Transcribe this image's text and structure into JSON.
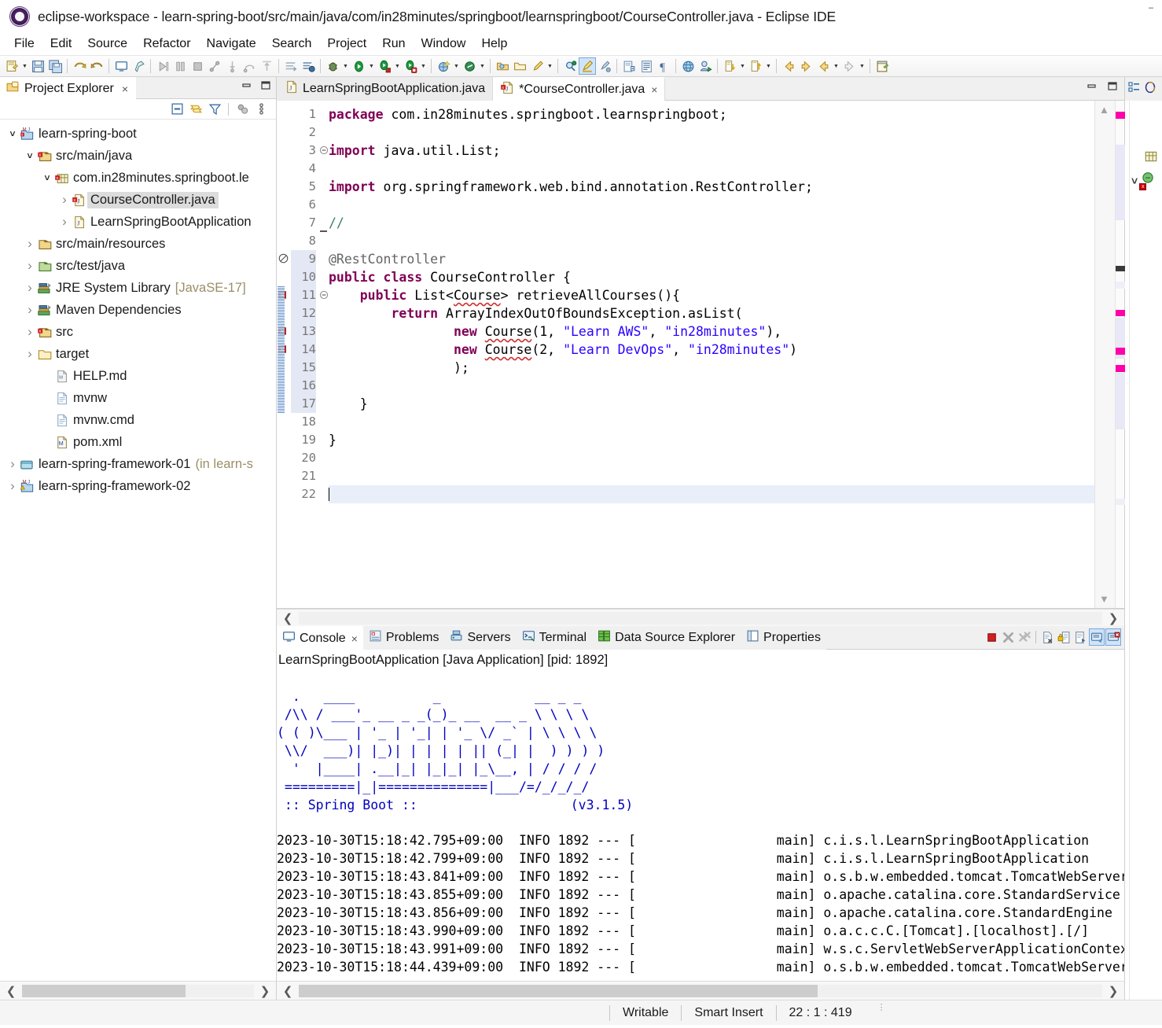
{
  "window": {
    "title": "eclipse-workspace - learn-spring-boot/src/main/java/com/in28minutes/springboot/learnspringboot/CourseController.java - Eclipse IDE",
    "app_icon": "eclipse-icon"
  },
  "menubar": {
    "items": [
      "File",
      "Edit",
      "Source",
      "Refactor",
      "Navigate",
      "Search",
      "Project",
      "Run",
      "Window",
      "Help"
    ]
  },
  "toolbar": {
    "groups": [
      {
        "items": [
          {
            "name": "new-wizard-icon",
            "arrow": true
          },
          {
            "name": "save-icon",
            "arrow": false
          },
          {
            "name": "save-all-icon",
            "arrow": false
          }
        ]
      },
      {
        "items": [
          {
            "name": "undo-icon",
            "arrow": false
          },
          {
            "name": "redo-icon",
            "arrow": false
          }
        ]
      },
      {
        "items": [
          {
            "name": "console-icon",
            "arrow": false
          },
          {
            "name": "pin-icon",
            "arrow": false
          }
        ]
      },
      {
        "items": [
          {
            "name": "resume-icon",
            "arrow": false
          },
          {
            "name": "suspend-icon",
            "arrow": false
          },
          {
            "name": "terminate-icon",
            "arrow": false
          },
          {
            "name": "disconnect-icon",
            "arrow": false
          },
          {
            "name": "step-into-icon",
            "arrow": false
          },
          {
            "name": "step-over-icon",
            "arrow": false
          },
          {
            "name": "step-return-icon",
            "arrow": false
          }
        ]
      },
      {
        "items": [
          {
            "name": "skip-breakpoints-icon",
            "arrow": false
          },
          {
            "name": "toggle-step-filters-icon",
            "arrow": false
          }
        ]
      },
      {
        "items": [
          {
            "name": "debug-icon",
            "arrow": true
          },
          {
            "name": "run-icon",
            "arrow": true
          },
          {
            "name": "run-as-server-icon",
            "arrow": true
          },
          {
            "name": "debug-as-server-icon",
            "arrow": true
          }
        ]
      },
      {
        "items": [
          {
            "name": "new-spring-starter-icon",
            "arrow": true
          },
          {
            "name": "boot-dashboard-icon",
            "arrow": true
          }
        ]
      },
      {
        "items": [
          {
            "name": "open-type-icon",
            "arrow": false
          },
          {
            "name": "open-task-icon",
            "arrow": false
          },
          {
            "name": "quick-access-icon",
            "arrow": true
          }
        ]
      },
      {
        "items": [
          {
            "name": "search-icon",
            "arrow": false
          },
          {
            "name": "highlight-icon",
            "arrow": false,
            "active": true
          },
          {
            "name": "toggle-mark-occurrences-icon",
            "arrow": false
          }
        ]
      },
      {
        "items": [
          {
            "name": "new-java-project-icon",
            "arrow": false
          },
          {
            "name": "new-class-icon",
            "arrow": false
          },
          {
            "name": "show-whitespace-icon",
            "arrow": false
          }
        ]
      },
      {
        "items": [
          {
            "name": "open-web-browser-icon",
            "arrow": false
          },
          {
            "name": "profile-icon",
            "arrow": false
          }
        ]
      },
      {
        "items": [
          {
            "name": "next-annotation-icon",
            "arrow": true
          },
          {
            "name": "previous-annotation-icon",
            "arrow": true
          }
        ]
      },
      {
        "items": [
          {
            "name": "back-icon",
            "arrow": false
          },
          {
            "name": "forward-icon",
            "arrow": false
          },
          {
            "name": "previous-edit-icon",
            "arrow": true
          },
          {
            "name": "next-edit-icon",
            "arrow": true
          }
        ]
      },
      {
        "items": [
          {
            "name": "new-window-icon",
            "arrow": false
          }
        ]
      }
    ]
  },
  "project_explorer": {
    "tab_label": "Project Explorer",
    "tab_icon": "project-explorer-icon",
    "close_label": "×",
    "view_tools": [
      "collapse-all-icon",
      "link-with-editor-icon",
      "filter-icon",
      "focus-active-task-icon",
      "view-menu-icon"
    ],
    "window_buttons": [
      "minimize-icon",
      "maximize-icon"
    ],
    "tree": [
      {
        "label": "learn-spring-boot",
        "indent": 0,
        "twisty": "open",
        "icon": "maven-java-project",
        "selected": false
      },
      {
        "label": "src/main/java",
        "indent": 1,
        "twisty": "open",
        "icon": "source-folder-error",
        "selected": false
      },
      {
        "label": "com.in28minutes.springboot.le",
        "indent": 2,
        "twisty": "open",
        "icon": "package-error",
        "selected": false
      },
      {
        "label": "CourseController.java",
        "indent": 3,
        "twisty": "closed",
        "icon": "java-file-error",
        "selected": true
      },
      {
        "label": "LearnSpringBootApplication",
        "indent": 3,
        "twisty": "closed",
        "icon": "java-file",
        "selected": false
      },
      {
        "label": "src/main/resources",
        "indent": 1,
        "twisty": "closed",
        "icon": "resource-folder",
        "selected": false
      },
      {
        "label": "src/test/java",
        "indent": 1,
        "twisty": "closed",
        "icon": "test-source-folder",
        "selected": false
      },
      {
        "label": "JRE System Library",
        "indent": 1,
        "twisty": "closed",
        "icon": "library",
        "selected": false,
        "suffix": "[JavaSE-17]"
      },
      {
        "label": "Maven Dependencies",
        "indent": 1,
        "twisty": "closed",
        "icon": "library",
        "selected": false
      },
      {
        "label": "src",
        "indent": 1,
        "twisty": "closed",
        "icon": "folder-error",
        "selected": false
      },
      {
        "label": "target",
        "indent": 1,
        "twisty": "closed",
        "icon": "folder",
        "selected": false
      },
      {
        "label": "HELP.md",
        "indent": 2,
        "twisty": "none",
        "icon": "markdown-file",
        "selected": false
      },
      {
        "label": "mvnw",
        "indent": 2,
        "twisty": "none",
        "icon": "text-file",
        "selected": false
      },
      {
        "label": "mvnw.cmd",
        "indent": 2,
        "twisty": "none",
        "icon": "text-file",
        "selected": false
      },
      {
        "label": "pom.xml",
        "indent": 2,
        "twisty": "none",
        "icon": "maven-pom-file",
        "selected": false
      },
      {
        "label": "learn-spring-framework-01",
        "indent": 0,
        "twisty": "closed",
        "icon": "closed-project",
        "selected": false,
        "suffix": "(in learn-s"
      },
      {
        "label": "learn-spring-framework-02",
        "indent": 0,
        "twisty": "closed",
        "icon": "maven-java-project-warn",
        "selected": false
      }
    ]
  },
  "editor": {
    "tabs": [
      {
        "label": "LearnSpringBootApplication.java",
        "icon": "java-file",
        "active": false,
        "dirty": false,
        "closable": false
      },
      {
        "label": "*CourseController.java",
        "icon": "java-file-error",
        "active": true,
        "dirty": true,
        "closable": true
      }
    ],
    "close_label": "×",
    "window_buttons": [
      "minimize-icon",
      "maximize-icon"
    ],
    "first_line": 1,
    "line_count": 22,
    "gutter_markers": [
      {
        "line": 9,
        "type": "warning-marker"
      },
      {
        "line": 11,
        "type": "error-marker"
      },
      {
        "line": 13,
        "type": "error-marker"
      },
      {
        "line": 14,
        "type": "error-marker"
      }
    ],
    "fold_markers": [
      3,
      11
    ],
    "highlighted_line": 22,
    "lines": [
      {
        "n": 1,
        "tokens": [
          {
            "t": "package ",
            "c": "kw"
          },
          {
            "t": "com.in28minutes.springboot.learnspringboot;",
            "c": "plain"
          }
        ]
      },
      {
        "n": 2,
        "tokens": []
      },
      {
        "n": 3,
        "tokens": [
          {
            "t": "import ",
            "c": "kw"
          },
          {
            "t": "java.util.List;",
            "c": "plain"
          }
        ]
      },
      {
        "n": 4,
        "tokens": []
      },
      {
        "n": 5,
        "tokens": [
          {
            "t": "import ",
            "c": "kw"
          },
          {
            "t": "org.springframework.web.bind.annotation.RestController;",
            "c": "plain"
          }
        ]
      },
      {
        "n": 6,
        "tokens": []
      },
      {
        "n": 7,
        "tokens": [
          {
            "t": "//",
            "c": "cmt"
          }
        ]
      },
      {
        "n": 8,
        "tokens": []
      },
      {
        "n": 9,
        "tokens": [
          {
            "t": "@RestController",
            "c": "ann"
          }
        ]
      },
      {
        "n": 10,
        "tokens": [
          {
            "t": "public class ",
            "c": "kw"
          },
          {
            "t": "CourseController {",
            "c": "plain"
          }
        ]
      },
      {
        "n": 11,
        "tokens": [
          {
            "t": "    ",
            "c": "plain"
          },
          {
            "t": "public ",
            "c": "kw"
          },
          {
            "t": "List<",
            "c": "plain"
          },
          {
            "t": "Course",
            "c": "plain err"
          },
          {
            "t": "> retrieveAllCourses(){",
            "c": "plain"
          }
        ]
      },
      {
        "n": 12,
        "tokens": [
          {
            "t": "        ",
            "c": "plain"
          },
          {
            "t": "return ",
            "c": "kw"
          },
          {
            "t": "ArrayIndexOutOfBoundsException.asList(",
            "c": "plain"
          }
        ]
      },
      {
        "n": 13,
        "tokens": [
          {
            "t": "                ",
            "c": "plain"
          },
          {
            "t": "new ",
            "c": "kw"
          },
          {
            "t": "Course",
            "c": "plain err"
          },
          {
            "t": "(1, ",
            "c": "plain"
          },
          {
            "t": "\"Learn AWS\"",
            "c": "str"
          },
          {
            "t": ", ",
            "c": "plain"
          },
          {
            "t": "\"in28minutes\"",
            "c": "str"
          },
          {
            "t": "),",
            "c": "plain"
          }
        ]
      },
      {
        "n": 14,
        "tokens": [
          {
            "t": "                ",
            "c": "plain"
          },
          {
            "t": "new ",
            "c": "kw"
          },
          {
            "t": "Course",
            "c": "plain err"
          },
          {
            "t": "(2, ",
            "c": "plain"
          },
          {
            "t": "\"Learn DevOps\"",
            "c": "str"
          },
          {
            "t": ", ",
            "c": "plain"
          },
          {
            "t": "\"in28minutes\"",
            "c": "str"
          },
          {
            "t": ")",
            "c": "plain"
          }
        ]
      },
      {
        "n": 15,
        "tokens": [
          {
            "t": "                );",
            "c": "plain"
          }
        ]
      },
      {
        "n": 16,
        "tokens": []
      },
      {
        "n": 17,
        "tokens": [
          {
            "t": "    }",
            "c": "plain"
          }
        ]
      },
      {
        "n": 18,
        "tokens": []
      },
      {
        "n": 19,
        "tokens": [
          {
            "t": "}",
            "c": "plain"
          }
        ]
      },
      {
        "n": 20,
        "tokens": []
      },
      {
        "n": 21,
        "tokens": []
      },
      {
        "n": 22,
        "tokens": []
      }
    ]
  },
  "console": {
    "tabs": [
      {
        "label": "Console",
        "icon": "console-icon",
        "active": true,
        "closable": true
      },
      {
        "label": "Problems",
        "icon": "problems-icon",
        "active": false,
        "closable": false
      },
      {
        "label": "Servers",
        "icon": "servers-icon",
        "active": false,
        "closable": false
      },
      {
        "label": "Terminal",
        "icon": "terminal-icon",
        "active": false,
        "closable": false
      },
      {
        "label": "Data Source Explorer",
        "icon": "data-source-icon",
        "active": false,
        "closable": false
      },
      {
        "label": "Properties",
        "icon": "properties-icon",
        "active": false,
        "closable": false
      }
    ],
    "close_label": "×",
    "tools": [
      {
        "name": "terminate-icon",
        "on": false
      },
      {
        "name": "remove-launch-icon",
        "on": false
      },
      {
        "name": "remove-all-launches-icon",
        "on": false
      },
      {
        "name": "clear-console-icon",
        "on": false
      },
      {
        "name": "scroll-lock-icon",
        "on": false
      },
      {
        "name": "pin-console-icon",
        "on": false
      },
      {
        "name": "display-selected-console-icon",
        "on": true
      },
      {
        "name": "open-console-icon",
        "on": true
      }
    ],
    "process_title": "LearnSpringBootApplication [Java Application]  [pid: 1892]",
    "banner": [
      "  .   ____          _            __ _ _",
      " /\\\\ / ___'_ __ _ _(_)_ __  __ _ \\ \\ \\ \\",
      "( ( )\\___ | '_ | '_| | '_ \\/ _` | \\ \\ \\ \\",
      " \\\\/  ___)| |_)| | | | | || (_| |  ) ) ) )",
      "  '  |____| .__|_| |_|_| |_\\__, | / / / /",
      " =========|_|==============|___/=/_/_/_/"
    ],
    "banner_footer_left": " :: Spring Boot :: ",
    "banner_footer_right": "(v3.1.5)",
    "log_lines": [
      {
        "ts": "2023-10-30T15:18:42.795+09:00",
        "level": "INFO",
        "pid": "1892",
        "thread": "main",
        "logger": "c.i.s.l.LearnSpringBootApplication"
      },
      {
        "ts": "2023-10-30T15:18:42.799+09:00",
        "level": "INFO",
        "pid": "1892",
        "thread": "main",
        "logger": "c.i.s.l.LearnSpringBootApplication"
      },
      {
        "ts": "2023-10-30T15:18:43.841+09:00",
        "level": "INFO",
        "pid": "1892",
        "thread": "main",
        "logger": "o.s.b.w.embedded.tomcat.TomcatWebServer"
      },
      {
        "ts": "2023-10-30T15:18:43.855+09:00",
        "level": "INFO",
        "pid": "1892",
        "thread": "main",
        "logger": "o.apache.catalina.core.StandardService"
      },
      {
        "ts": "2023-10-30T15:18:43.856+09:00",
        "level": "INFO",
        "pid": "1892",
        "thread": "main",
        "logger": "o.apache.catalina.core.StandardEngine"
      },
      {
        "ts": "2023-10-30T15:18:43.990+09:00",
        "level": "INFO",
        "pid": "1892",
        "thread": "main",
        "logger": "o.a.c.c.C.[Tomcat].[localhost].[/]"
      },
      {
        "ts": "2023-10-30T15:18:43.991+09:00",
        "level": "INFO",
        "pid": "1892",
        "thread": "main",
        "logger": "w.s.c.ServletWebServerApplicationContex"
      },
      {
        "ts": "2023-10-30T15:18:44.439+09:00",
        "level": "INFO",
        "pid": "1892",
        "thread": "main",
        "logger": "o.s.b.w.embedded.tomcat.TomcatWebServer"
      }
    ]
  },
  "outline": {
    "tabs": [
      "outline-icon",
      "task-list-icon"
    ],
    "nodes": [
      {
        "icon": "package-declaration-icon",
        "indent": 1,
        "twisty": "none"
      },
      {
        "icon": "class-error-icon",
        "indent": 0,
        "twisty": "open"
      }
    ]
  },
  "status_bar": {
    "writable": "Writable",
    "insert_mode": "Smart Insert",
    "position": "22 : 1 : 419"
  },
  "colors": {
    "keyword": "#7f0055",
    "string": "#2a00ff",
    "comment": "#3f7f5f",
    "annotation": "#646464",
    "error_marker": "#cc0000",
    "warning_marker": "#f0c000",
    "banner": "#0000c0",
    "selection": "#dcdcdc",
    "highlight_line": "#e9eff9",
    "ruler_error": "#ff00aa"
  }
}
